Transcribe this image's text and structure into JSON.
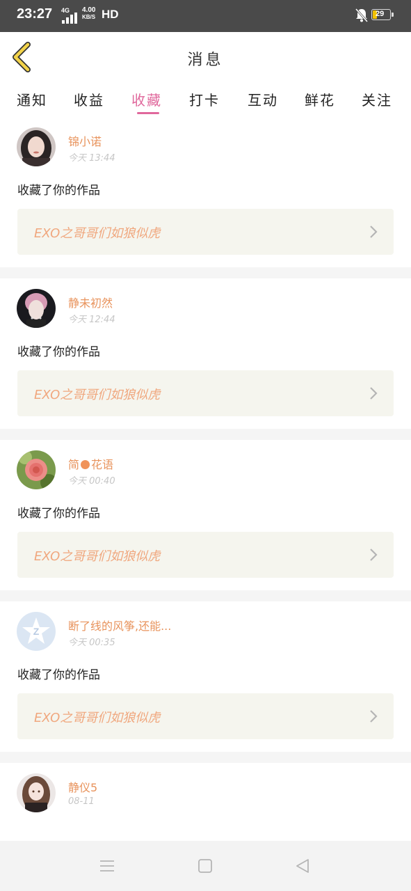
{
  "status_bar": {
    "time": "23:27",
    "network": "4G",
    "speed_value": "4.00",
    "speed_unit": "KB/S",
    "hd": "HD",
    "battery": "29"
  },
  "header": {
    "title": "消息"
  },
  "tabs": [
    {
      "label": "通知",
      "active": false
    },
    {
      "label": "收益",
      "active": false
    },
    {
      "label": "收藏",
      "active": true
    },
    {
      "label": "打卡",
      "active": false
    },
    {
      "label": "互动",
      "active": false
    },
    {
      "label": "鲜花",
      "active": false
    },
    {
      "label": "关注",
      "active": false
    }
  ],
  "colors": {
    "accent": "#e0689c",
    "username": "#e8935c",
    "work_title": "#f0a77e",
    "work_box_bg": "#f5f5ee"
  },
  "messages": [
    {
      "username": "锦小诺",
      "time": "今天 13:44",
      "action": "收藏了你的作品",
      "work_title": "EXO之哥哥们如狼似虎",
      "avatar_icon": "girl-portrait"
    },
    {
      "username": "静未初然",
      "time": "今天 12:44",
      "action": "收藏了你的作品",
      "work_title": "EXO之哥哥们如狼似虎",
      "avatar_icon": "pink-hair-portrait"
    },
    {
      "username_prefix": "简",
      "username_suffix": "花语",
      "time": "今天 00:40",
      "action": "收藏了你的作品",
      "work_title": "EXO之哥哥们如狼似虎",
      "avatar_icon": "rose-flower"
    },
    {
      "username": "断了线的风筝,还能...",
      "time": "今天 00:35",
      "action": "收藏了你的作品",
      "work_title": "EXO之哥哥们如狼似虎",
      "avatar_icon": "default-star-avatar"
    },
    {
      "username": "静仪5",
      "time": "08-11",
      "avatar_icon": "anime-girl"
    }
  ],
  "nav": {
    "menu_icon": "menu-icon",
    "home_icon": "home-square-icon",
    "back_icon": "back-triangle-icon"
  }
}
